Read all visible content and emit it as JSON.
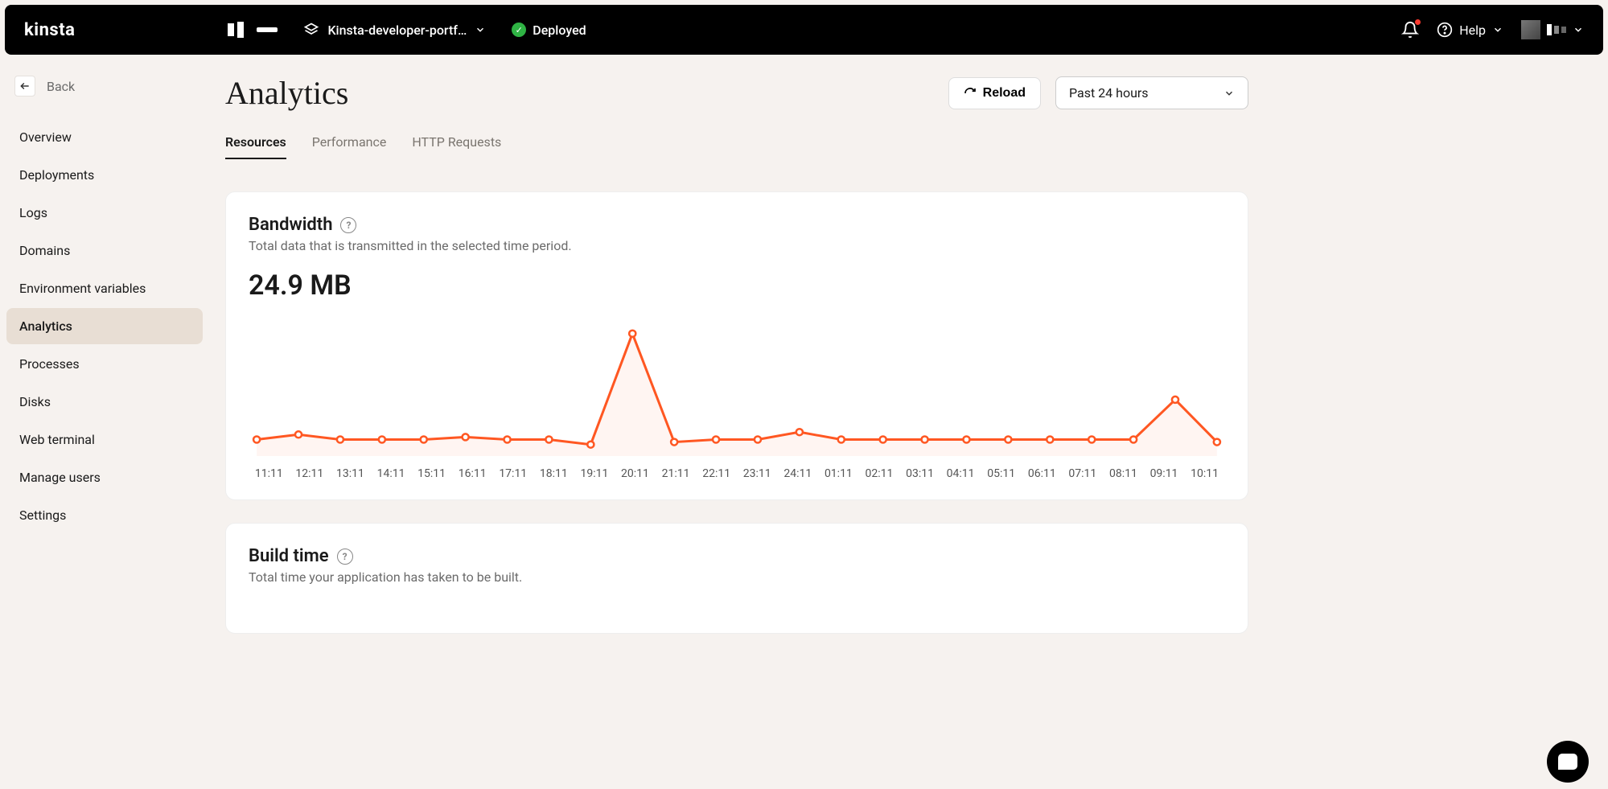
{
  "topbar": {
    "logo": "kinsta",
    "project_name": "Kinsta-developer-portf…",
    "status_text": "Deployed",
    "help_label": "Help"
  },
  "sidebar": {
    "back_label": "Back",
    "items": [
      {
        "label": "Overview"
      },
      {
        "label": "Deployments"
      },
      {
        "label": "Logs"
      },
      {
        "label": "Domains"
      },
      {
        "label": "Environment variables"
      },
      {
        "label": "Analytics"
      },
      {
        "label": "Processes"
      },
      {
        "label": "Disks"
      },
      {
        "label": "Web terminal"
      },
      {
        "label": "Manage users"
      },
      {
        "label": "Settings"
      }
    ],
    "active_index": 5
  },
  "header": {
    "title": "Analytics",
    "reload_label": "Reload",
    "timerange_label": "Past 24 hours"
  },
  "tabs": [
    {
      "label": "Resources",
      "active": true
    },
    {
      "label": "Performance",
      "active": false
    },
    {
      "label": "HTTP Requests",
      "active": false
    }
  ],
  "bandwidth_card": {
    "title": "Bandwidth",
    "subtitle": "Total data that is transmitted in the selected time period.",
    "value": "24.9 MB"
  },
  "buildtime_card": {
    "title": "Build time",
    "subtitle": "Total time your application has taken to be built."
  },
  "chart_data": {
    "type": "line",
    "title": "Bandwidth",
    "xlabel": "",
    "ylabel": "",
    "ylim": [
      0,
      100
    ],
    "categories": [
      "11:11",
      "12:11",
      "13:11",
      "14:11",
      "15:11",
      "16:11",
      "17:11",
      "18:11",
      "19:11",
      "20:11",
      "21:11",
      "22:11",
      "23:11",
      "24:11",
      "01:11",
      "02:11",
      "03:11",
      "04:11",
      "05:11",
      "06:11",
      "07:11",
      "08:11",
      "09:11",
      "10:11"
    ],
    "series": [
      {
        "name": "Bandwidth",
        "values": [
          10,
          14,
          10,
          10,
          10,
          12,
          10,
          10,
          6,
          95,
          8,
          10,
          10,
          16,
          10,
          10,
          10,
          10,
          10,
          10,
          10,
          10,
          42,
          8
        ]
      }
    ]
  },
  "colors": {
    "accent": "#ff5722",
    "status_ok": "#2fb344"
  }
}
